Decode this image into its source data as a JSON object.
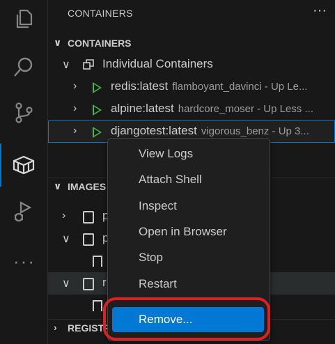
{
  "sidebar": {
    "title": "CONTAINERS",
    "more": "···"
  },
  "containers_section": {
    "label": "CONTAINERS",
    "group_label": "Individual Containers",
    "items": [
      {
        "name": "redis:latest",
        "desc": "flamboyant_davinci - Up Le..."
      },
      {
        "name": "alpine:latest",
        "desc": "hardcore_moser - Up Less ..."
      },
      {
        "name": "djangotest:latest",
        "desc": "vigorous_benz - Up 3..."
      }
    ]
  },
  "images_section": {
    "label": "IMAGES",
    "items": [
      {
        "label": "p"
      },
      {
        "label": "p"
      },
      {
        "label": "r"
      }
    ]
  },
  "registries_section": {
    "label": "REGISTRIES"
  },
  "context_menu": {
    "items": [
      "View Logs",
      "Attach Shell",
      "Inspect",
      "Open in Browser",
      "Stop",
      "Restart",
      "Remove..."
    ],
    "active_index": 6
  },
  "activity_bar": {
    "icons": [
      "explorer-icon",
      "search-icon",
      "source-control-icon",
      "docker-icon",
      "run-debug-icon"
    ],
    "more": "···"
  },
  "colors": {
    "accent": "#0078d4",
    "running": "#3fb950",
    "annotation": "#e02020"
  }
}
